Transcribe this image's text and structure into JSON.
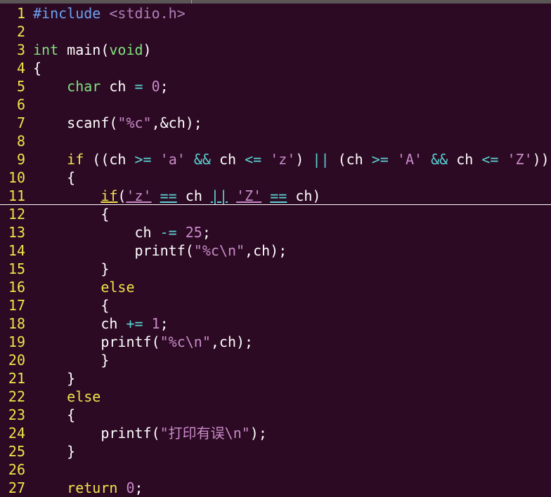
{
  "editor": {
    "cursor_line": 11,
    "colors": {
      "background": "#2c0a23",
      "line_number": "#f1e34b",
      "preproc": "#6ba3f2",
      "type": "#7fe07f",
      "statement": "#f1e34b",
      "constant": "#c88ac8",
      "operator": "#5ad3d3",
      "text": "#ffffff"
    },
    "lines": [
      {
        "n": "1",
        "tokens": [
          [
            "preproc",
            "#include "
          ],
          [
            "incstr",
            "<stdio.h>"
          ]
        ]
      },
      {
        "n": "2",
        "tokens": []
      },
      {
        "n": "3",
        "tokens": [
          [
            "type",
            "int"
          ],
          [
            "default",
            " main("
          ],
          [
            "type",
            "void"
          ],
          [
            "default",
            ")"
          ]
        ]
      },
      {
        "n": "4",
        "tokens": [
          [
            "default",
            "{"
          ]
        ]
      },
      {
        "n": "5",
        "tokens": [
          [
            "default",
            "    "
          ],
          [
            "type",
            "char"
          ],
          [
            "default",
            " ch "
          ],
          [
            "op",
            "="
          ],
          [
            "default",
            " "
          ],
          [
            "number",
            "0"
          ],
          [
            "default",
            ";"
          ]
        ]
      },
      {
        "n": "6",
        "tokens": []
      },
      {
        "n": "7",
        "tokens": [
          [
            "default",
            "    scanf("
          ],
          [
            "string",
            "\"%c\""
          ],
          [
            "default",
            ",&ch);"
          ]
        ]
      },
      {
        "n": "8",
        "tokens": []
      },
      {
        "n": "9",
        "tokens": [
          [
            "default",
            "    "
          ],
          [
            "stmt",
            "if"
          ],
          [
            "default",
            " ((ch "
          ],
          [
            "op",
            ">="
          ],
          [
            "default",
            " "
          ],
          [
            "char",
            "'a'"
          ],
          [
            "default",
            " "
          ],
          [
            "op",
            "&&"
          ],
          [
            "default",
            " ch "
          ],
          [
            "op",
            "<="
          ],
          [
            "default",
            " "
          ],
          [
            "char",
            "'z'"
          ],
          [
            "default",
            ") "
          ],
          [
            "op",
            "||"
          ],
          [
            "default",
            " (ch "
          ],
          [
            "op",
            ">="
          ],
          [
            "default",
            " "
          ],
          [
            "char",
            "'A'"
          ],
          [
            "default",
            " "
          ],
          [
            "op",
            "&&"
          ],
          [
            "default",
            " ch "
          ],
          [
            "op",
            "<="
          ],
          [
            "default",
            " "
          ],
          [
            "char",
            "'Z'"
          ],
          [
            "default",
            "))"
          ]
        ]
      },
      {
        "n": "10",
        "tokens": [
          [
            "default",
            "    {"
          ]
        ]
      },
      {
        "n": "11",
        "tokens": [
          [
            "default",
            "        "
          ],
          [
            "stmt",
            "if"
          ],
          [
            "default",
            "("
          ],
          [
            "char",
            "'z'"
          ],
          [
            "default",
            " "
          ],
          [
            "op",
            "=="
          ],
          [
            "default",
            " ch "
          ],
          [
            "op",
            "||"
          ],
          [
            "default",
            " "
          ],
          [
            "char",
            "'Z'"
          ],
          [
            "default",
            " "
          ],
          [
            "op",
            "=="
          ],
          [
            "default",
            " ch)"
          ]
        ]
      },
      {
        "n": "12",
        "tokens": [
          [
            "default",
            "        {"
          ]
        ]
      },
      {
        "n": "13",
        "tokens": [
          [
            "default",
            "            ch "
          ],
          [
            "op",
            "-="
          ],
          [
            "default",
            " "
          ],
          [
            "number",
            "25"
          ],
          [
            "default",
            ";"
          ]
        ]
      },
      {
        "n": "14",
        "tokens": [
          [
            "default",
            "            printf("
          ],
          [
            "string",
            "\"%c\\n\""
          ],
          [
            "default",
            ",ch);"
          ]
        ]
      },
      {
        "n": "15",
        "tokens": [
          [
            "default",
            "        }"
          ]
        ]
      },
      {
        "n": "16",
        "tokens": [
          [
            "default",
            "        "
          ],
          [
            "stmt",
            "else"
          ]
        ]
      },
      {
        "n": "17",
        "tokens": [
          [
            "default",
            "        {"
          ]
        ]
      },
      {
        "n": "18",
        "tokens": [
          [
            "default",
            "        ch "
          ],
          [
            "op",
            "+="
          ],
          [
            "default",
            " "
          ],
          [
            "number",
            "1"
          ],
          [
            "default",
            ";"
          ]
        ]
      },
      {
        "n": "19",
        "tokens": [
          [
            "default",
            "        printf("
          ],
          [
            "string",
            "\"%c\\n\""
          ],
          [
            "default",
            ",ch);"
          ]
        ]
      },
      {
        "n": "20",
        "tokens": [
          [
            "default",
            "        }"
          ]
        ]
      },
      {
        "n": "21",
        "tokens": [
          [
            "default",
            "    }"
          ]
        ]
      },
      {
        "n": "22",
        "tokens": [
          [
            "default",
            "    "
          ],
          [
            "stmt",
            "else"
          ]
        ]
      },
      {
        "n": "23",
        "tokens": [
          [
            "default",
            "    {"
          ]
        ]
      },
      {
        "n": "24",
        "tokens": [
          [
            "default",
            "        printf("
          ],
          [
            "string",
            "\"打印有误\\n\""
          ],
          [
            "default",
            ");"
          ]
        ]
      },
      {
        "n": "25",
        "tokens": [
          [
            "default",
            "    }"
          ]
        ]
      },
      {
        "n": "26",
        "tokens": []
      },
      {
        "n": "27",
        "tokens": [
          [
            "default",
            "    "
          ],
          [
            "stmt",
            "return"
          ],
          [
            "default",
            " "
          ],
          [
            "number",
            "0"
          ],
          [
            "default",
            ";"
          ]
        ]
      }
    ]
  }
}
